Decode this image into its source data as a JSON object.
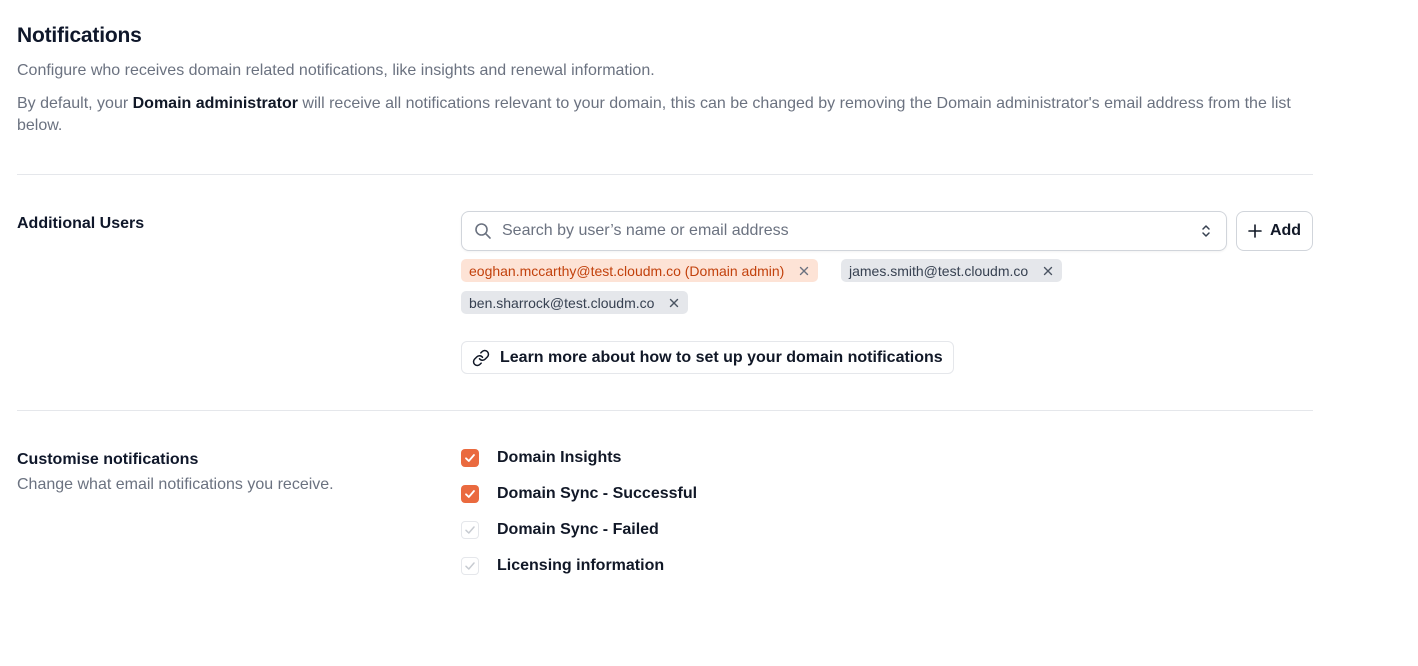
{
  "header": {
    "title": "Notifications",
    "description": "Configure who receives domain related notifications, like insights and renewal information.",
    "default_prefix": "By default, your ",
    "default_strong": "Domain administrator",
    "default_suffix": " will receive all notifications relevant to your domain, this can be changed by removing the Domain administrator's email address from the list below."
  },
  "additional_users": {
    "label": "Additional Users",
    "search_placeholder": "Search by user’s name or email address",
    "add_label": "Add",
    "chips": [
      {
        "email": "eoghan.mccarthy@test.cloudm.co (Domain admin)",
        "admin": true
      },
      {
        "email": "james.smith@test.cloudm.co",
        "admin": false
      },
      {
        "email": "ben.sharrock@test.cloudm.co",
        "admin": false
      }
    ],
    "learn_more": "Learn more about how to set up your domain notifications"
  },
  "customise": {
    "label": "Customise notifications",
    "sub": "Change what email notifications you receive.",
    "options": [
      {
        "label": "Domain Insights",
        "checked": true
      },
      {
        "label": "Domain Sync - Successful",
        "checked": true
      },
      {
        "label": "Domain Sync - Failed",
        "checked": false
      },
      {
        "label": "Licensing information",
        "checked": false
      }
    ]
  },
  "colors": {
    "accent": "#ea6a3f",
    "admin_chip_bg": "#fde3d6",
    "admin_chip_text": "#c2410c",
    "chip_bg": "#e5e7eb",
    "muted_text": "#6b7280"
  },
  "icons": {
    "search": "search-icon",
    "chevron": "chevron-up-down-icon",
    "add": "plus-icon",
    "remove": "close-icon",
    "link": "link-icon",
    "check": "check-icon"
  }
}
